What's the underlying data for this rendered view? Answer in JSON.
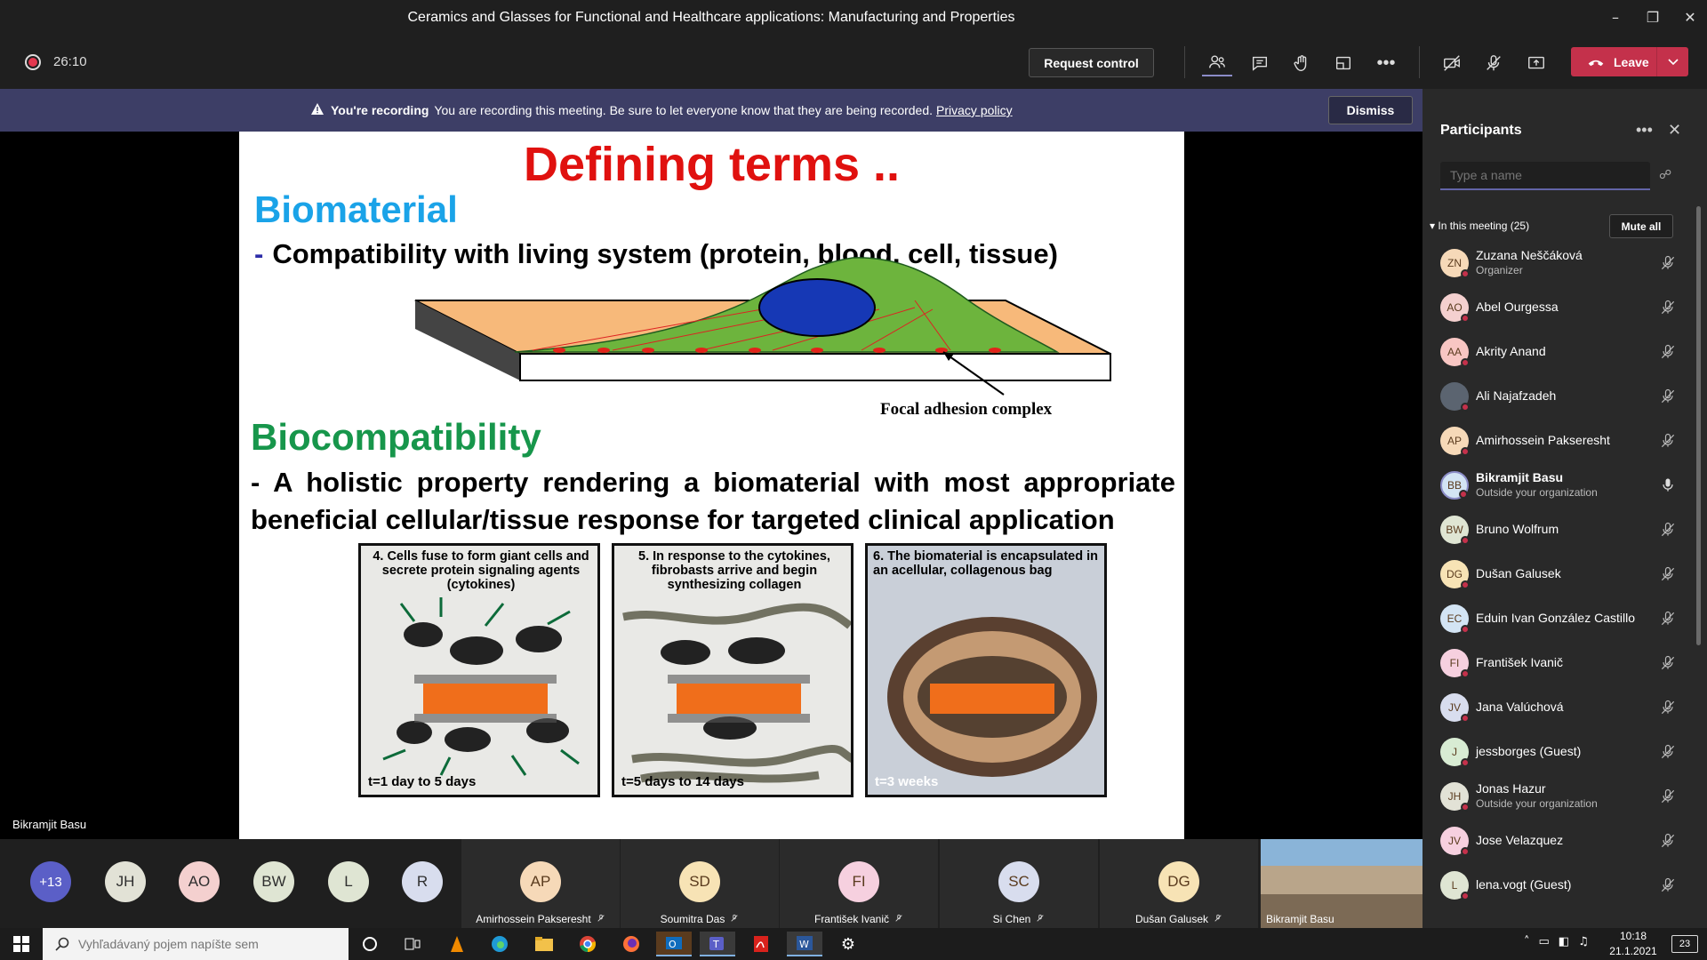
{
  "window": {
    "title": "Ceramics and Glasses for Functional and Healthcare applications: Manufacturing and Properties"
  },
  "toolbar": {
    "timer": "26:10",
    "request_control": "Request control",
    "leave": "Leave"
  },
  "banner": {
    "label": "You're recording",
    "message": "You are recording this meeting. Be sure to let everyone know that they are being recorded.",
    "link": "Privacy policy",
    "dismiss": "Dismiss"
  },
  "stage": {
    "presenter": "Bikramjit Basu"
  },
  "slide": {
    "title": "Defining terms ..",
    "heading1": "Biomaterial",
    "bullet1_dash": "-",
    "bullet1": "Compatibility with living system (protein, blood, cell, tissue)",
    "figure_label": "Focal adhesion complex",
    "heading2": "Biocompatibility",
    "bullet2": "-  A holistic property rendering a biomaterial with most appropriate beneficial cellular/tissue response for targeted clinical application",
    "panels": [
      {
        "caption": "4. Cells fuse to form giant cells and secrete protein signaling agents (cytokines)",
        "time": "t=1 day to 5 days"
      },
      {
        "caption": "5. In response to the cytokines, fibrobasts arrive and begin synthesizing collagen",
        "time": "t=5 days to 14 days"
      },
      {
        "caption": "6. The biomaterial is encapsulated in an acellular, collagenous bag",
        "time": "t=3 weeks"
      }
    ]
  },
  "participants_panel": {
    "title": "Participants",
    "search_placeholder": "Type a name",
    "in_meeting": "In this meeting (25)",
    "mute_all": "Mute all",
    "list": [
      {
        "initials": "ZN",
        "name": "Zuzana Neščáková",
        "sub": "Organizer",
        "color": "#f6d9b8"
      },
      {
        "initials": "AO",
        "name": "Abel Ourgessa",
        "sub": "",
        "color": "#f4d0cf"
      },
      {
        "initials": "AA",
        "name": "Akrity Anand",
        "sub": "",
        "color": "#f8c6c3"
      },
      {
        "initials": "",
        "name": "Ali Najafzadeh",
        "sub": "",
        "color": "#5b6470"
      },
      {
        "initials": "AP",
        "name": "Amirhossein Pakseresht",
        "sub": "",
        "color": "#f6d9b8"
      },
      {
        "initials": "BB",
        "name": "Bikramjit Basu",
        "sub": "Outside your organization",
        "color": "#d3e4f4"
      },
      {
        "initials": "BW",
        "name": "Bruno Wolfrum",
        "sub": "",
        "color": "#dfe5d3"
      },
      {
        "initials": "DG",
        "name": "Dušan Galusek",
        "sub": "",
        "color": "#f7e3b5"
      },
      {
        "initials": "EC",
        "name": "Eduin Ivan González Castillo",
        "sub": "",
        "color": "#d3e4f4"
      },
      {
        "initials": "FI",
        "name": "František Ivanič",
        "sub": "",
        "color": "#f6d0df"
      },
      {
        "initials": "JV",
        "name": "Jana Valúchová",
        "sub": "",
        "color": "#d8ddee"
      },
      {
        "initials": "J",
        "name": "jessborges (Guest)",
        "sub": "",
        "color": "#d8ecd3"
      },
      {
        "initials": "JH",
        "name": "Jonas Hazur",
        "sub": "Outside your organization",
        "color": "#e2e2d6"
      },
      {
        "initials": "JV",
        "name": "Jose Velazquez",
        "sub": "",
        "color": "#f6d0df"
      },
      {
        "initials": "L",
        "name": "lena.vogt (Guest)",
        "sub": "",
        "color": "#dfe5d3"
      }
    ]
  },
  "strip": {
    "overflow": "+13",
    "small": [
      {
        "initials": "JH",
        "color": "#e2e2d6"
      },
      {
        "initials": "AO",
        "color": "#f4d0cf"
      },
      {
        "initials": "BW",
        "color": "#dfe5d3"
      },
      {
        "initials": "L",
        "color": "#dfe5d3"
      },
      {
        "initials": "R",
        "color": "#d8ddee"
      }
    ],
    "tiles": [
      {
        "initials": "AP",
        "name": "Amirhossein Pakseresht",
        "color": "#f6d9b8"
      },
      {
        "initials": "SD",
        "name": "Soumitra Das",
        "color": "#f7e3b5"
      },
      {
        "initials": "FI",
        "name": "František Ivanič",
        "color": "#f6d0df"
      },
      {
        "initials": "SC",
        "name": "Si Chen",
        "color": "#d8ddee"
      },
      {
        "initials": "DG",
        "name": "Dušan Galusek",
        "color": "#f7e3b5"
      }
    ],
    "self": "Bikramjit Basu"
  },
  "taskbar": {
    "search_placeholder": "Vyhľadávaný pojem napíšte sem",
    "time": "10:18",
    "date": "21.1.2021",
    "notifications": "23"
  }
}
